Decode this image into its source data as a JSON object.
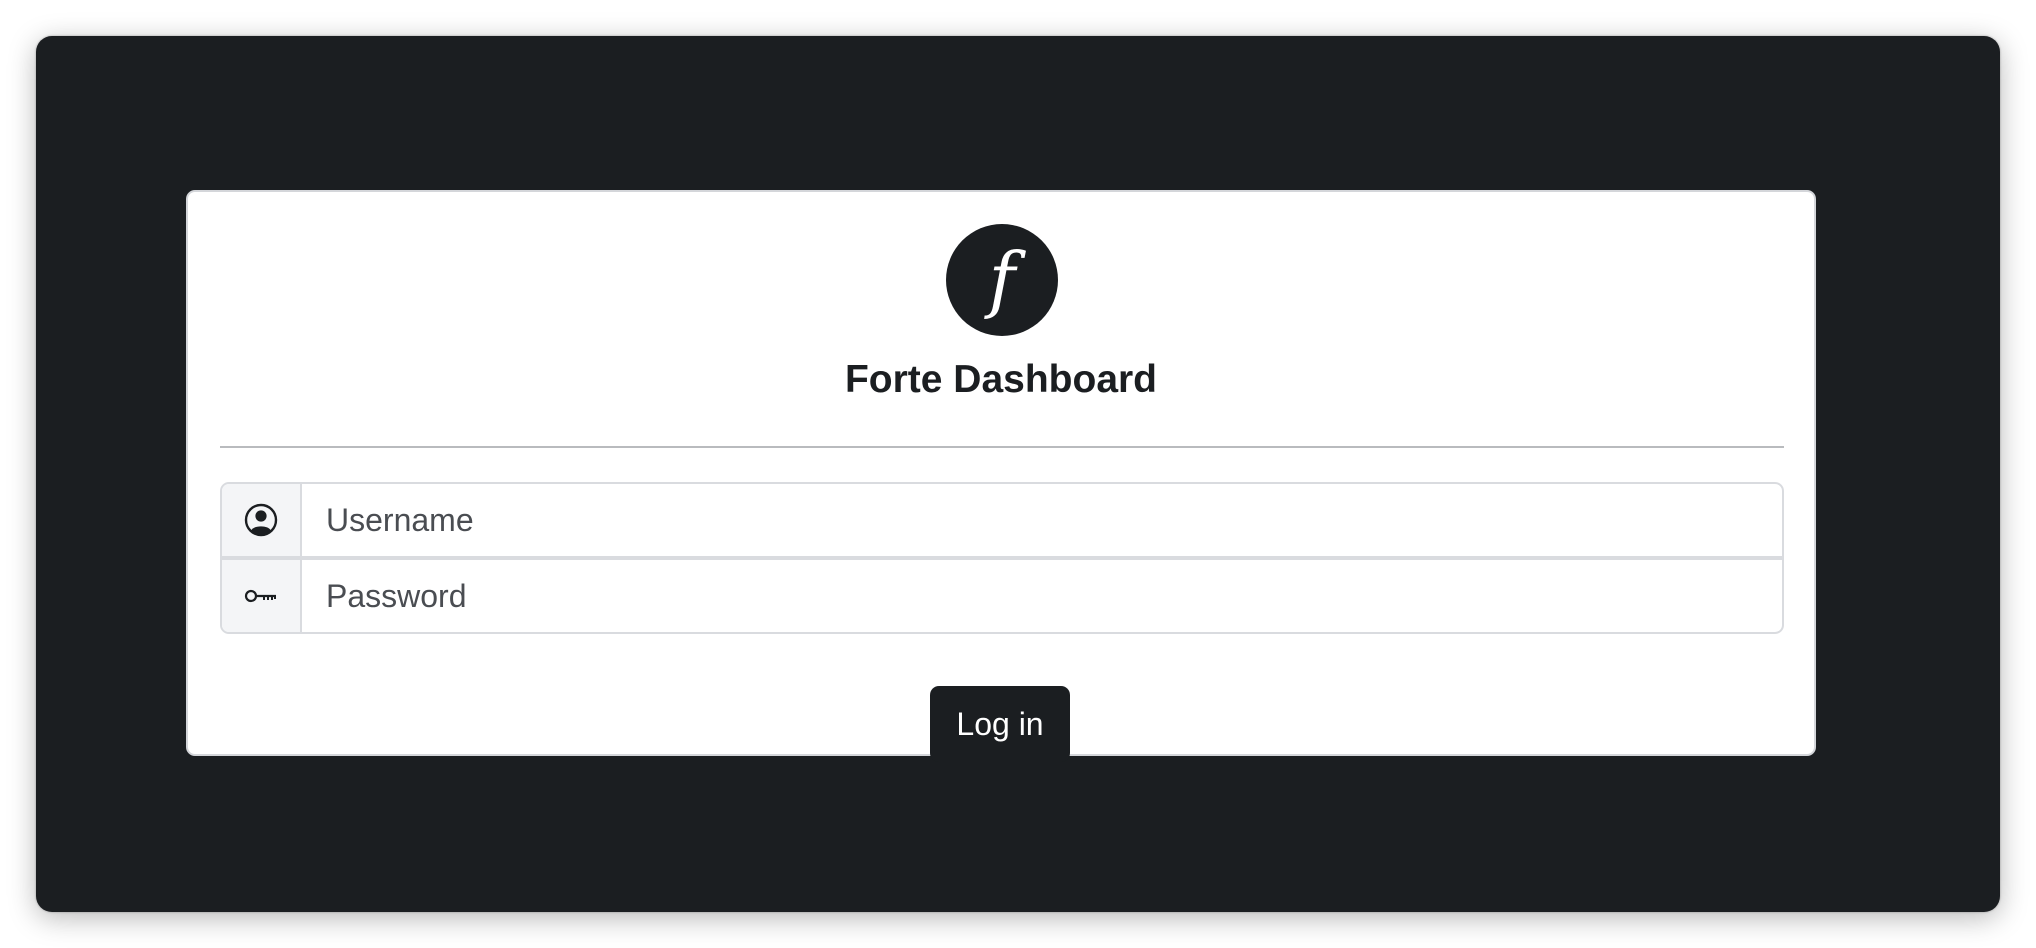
{
  "app": {
    "title": "Forte Dashboard"
  },
  "logo": {
    "icon": "forte-f-logo",
    "glyph": "𝑓"
  },
  "form": {
    "username": {
      "placeholder": "Username",
      "value": "",
      "icon": "user-circle-icon"
    },
    "password": {
      "placeholder": "Password",
      "value": "",
      "icon": "key-icon"
    },
    "submit_label": "Log in"
  },
  "colors": {
    "background": "#1b1e21",
    "card": "#ffffff",
    "button": "#1b1e21",
    "button_text": "#ffffff"
  }
}
